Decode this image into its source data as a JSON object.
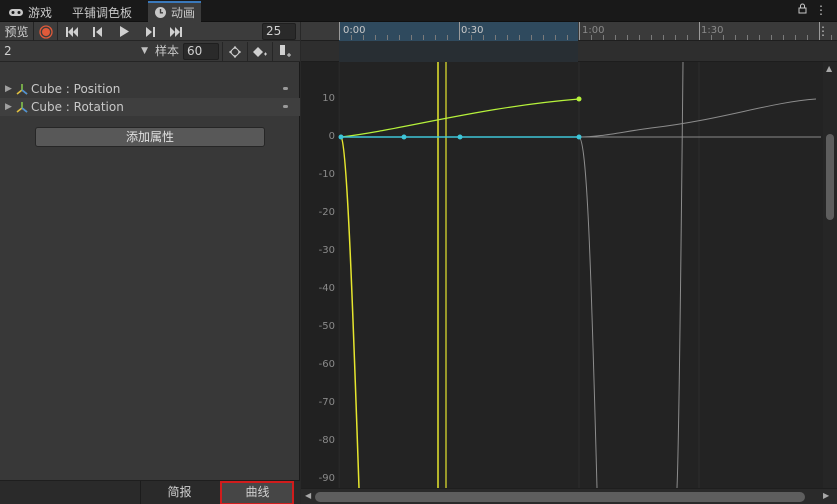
{
  "tabs": [
    {
      "label": "游戏",
      "icon": "gamepad-icon"
    },
    {
      "label": "平铺调色板",
      "icon": ""
    },
    {
      "label": "动画",
      "icon": "clock-icon"
    }
  ],
  "toolbar": {
    "preview_label": "预览",
    "frame_value": "25",
    "clip_name": "2",
    "sample_label": "样本",
    "sample_value": "60"
  },
  "properties": [
    {
      "label": "Cube : Position"
    },
    {
      "label": "Cube : Rotation"
    }
  ],
  "add_property_label": "添加属性",
  "bottom_tabs": [
    {
      "label": "简报",
      "active": false
    },
    {
      "label": "曲线",
      "active": true
    }
  ],
  "timeline": {
    "labels": [
      "0:00",
      "0:30",
      "1:00",
      "1:30"
    ]
  },
  "y_axis_labels": [
    "10",
    "0",
    "-10",
    "-20",
    "-30",
    "-40",
    "-50",
    "-60",
    "-70",
    "-80",
    "-90"
  ],
  "colors": {
    "accent_tab": "#3a79bb",
    "record": "#e05a3a",
    "curve_yellow": "#e6e62e",
    "curve_green": "#b6f23b",
    "curve_cyan": "#3ec5d8",
    "highlight_outline": "#d11c1c"
  }
}
